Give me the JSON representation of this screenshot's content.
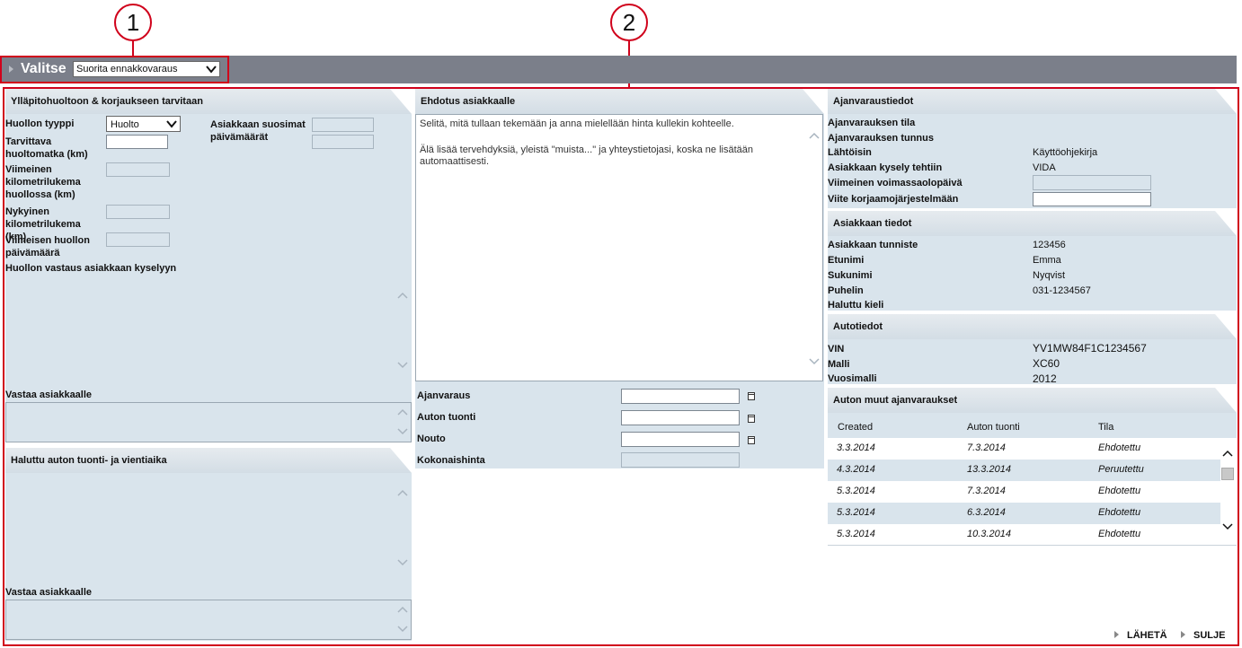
{
  "callouts": [
    "1",
    "2"
  ],
  "header": {
    "title": "Valitse",
    "select_value": "Suorita ennakkovaraus"
  },
  "left": {
    "section1_title": "Ylläpitohuoltoon & korjaukseen tarvitaan",
    "service_type_label": "Huollon tyyppi",
    "service_type_value": "Huolto",
    "interval_label": "Tarvittava huoltomatka (km)",
    "last_mileage_label": "Viimeinen kilometrilukema huollossa (km)",
    "current_mileage_label": "Nykyinen kilometrilukema (km)",
    "last_service_date_label": "Viimeisen huollon päivämäärä",
    "preferred_dates_label": "Asiakkaan suosimat päivämäärät",
    "workshop_reply_label": "Huollon vastaus asiakkaan kyselyyn",
    "reply_label": "Vastaa asiakkaalle",
    "section2_title": "Haluttu auton tuonti- ja vientiaika",
    "reply2_label": "Vastaa asiakkaalle"
  },
  "middle": {
    "title": "Ehdotus asiakkaalle",
    "text_line1": "Selitä, mitä tullaan tekemään ja anna mielellään hinta kullekin kohteelle.",
    "text_line2": "Älä lisää tervehdyksiä, yleistä \"muista...\" ja yhteystietojasi, koska ne lisätään automaattisesti.",
    "booking_label": "Ajanvaraus",
    "dropoff_label": "Auton tuonti",
    "pickup_label": "Nouto",
    "total_label": "Kokonaishinta"
  },
  "right": {
    "booking_info_title": "Ajanvaraustiedot",
    "status_label": "Ajanvarauksen tila",
    "id_label": "Ajanvarauksen tunnus",
    "source_label": "Lähtöisin",
    "source_value": "Käyttöohjekirja",
    "query_made_label": "Asiakkaan kysely tehtiin",
    "query_made_value": "VIDA",
    "expiry_label": "Viimeinen voimassaolopäivä",
    "reference_label": "Viite korjaamojärjestelmään",
    "customer_title": "Asiakkaan tiedot",
    "customer_id_label": "Asiakkaan tunniste",
    "customer_id_value": "123456",
    "first_name_label": "Etunimi",
    "first_name_value": "Emma",
    "last_name_label": "Sukunimi",
    "last_name_value": "Nyqvist",
    "phone_label": "Puhelin",
    "phone_value": "031-1234567",
    "language_label": "Haluttu kieli",
    "car_title": "Autotiedot",
    "vin_label": "VIN",
    "vin_value": "YV1MW84F1C1234567",
    "model_label": "Malli",
    "model_value": "XC60",
    "year_label": "Vuosimalli",
    "year_value": "2012",
    "other_title": "Auton muut ajanvaraukset",
    "columns": [
      "Created",
      "Auton tuonti",
      "Tila"
    ],
    "rows": [
      {
        "created": "3.3.2014",
        "dropoff": "7.3.2014",
        "status": "Ehdotettu"
      },
      {
        "created": "4.3.2014",
        "dropoff": "13.3.2014",
        "status": "Peruutettu"
      },
      {
        "created": "5.3.2014",
        "dropoff": "7.3.2014",
        "status": "Ehdotettu"
      },
      {
        "created": "5.3.2014",
        "dropoff": "6.3.2014",
        "status": "Ehdotettu"
      },
      {
        "created": "5.3.2014",
        "dropoff": "10.3.2014",
        "status": "Ehdotettu"
      }
    ]
  },
  "footer": {
    "send_label": "LÄHETÄ",
    "close_label": "SULJE"
  }
}
